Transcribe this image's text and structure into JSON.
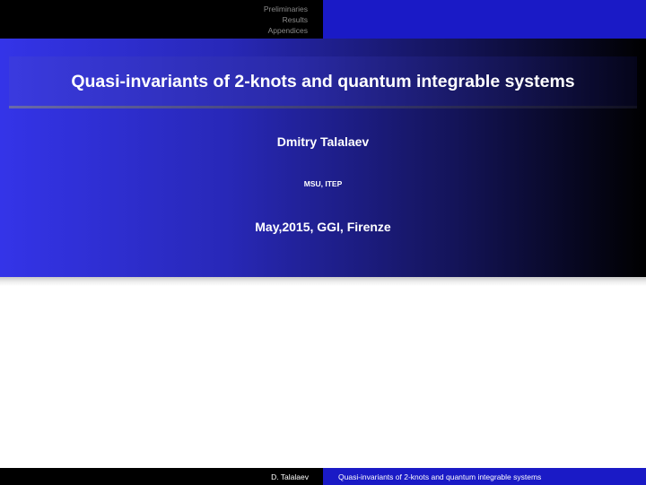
{
  "navigation": {
    "sections": [
      "Preliminaries",
      "Results",
      "Appendices"
    ]
  },
  "title_slide": {
    "title": "Quasi-invariants of 2-knots and quantum integrable systems",
    "author": "Dmitry Talalaev",
    "institute": "MSU, ITEP",
    "date": "May,2015, GGI, Firenze"
  },
  "footer": {
    "author": "D. Talalaev",
    "short_title": "Quasi-invariants of 2-knots and quantum integrable systems"
  },
  "colors": {
    "headline_left": "#000000",
    "headline_right": "#1a1ac6",
    "nav_text": "#8a8a8a",
    "title_gradient_start": "#3434e8",
    "title_gradient_end": "#000000",
    "text": "#ffffff"
  }
}
